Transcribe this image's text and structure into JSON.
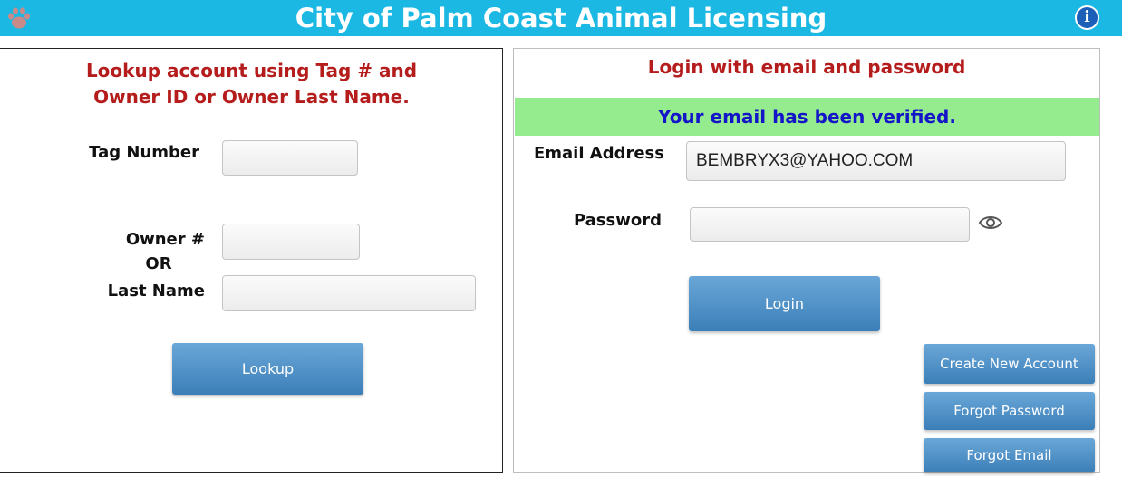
{
  "header": {
    "title": "City of Palm Coast Animal Licensing",
    "info_label": "i",
    "colors": {
      "background": "#1cb8e4",
      "text": "#ffffff"
    },
    "icons": {
      "logo": "paw-icon",
      "info": "info-icon"
    }
  },
  "lookup": {
    "heading_line1": "Lookup account using Tag # and",
    "heading_line2": "Owner ID or Owner Last Name.",
    "tag_label": "Tag Number",
    "tag_value": "",
    "owner_label": "Owner #",
    "or_label": "OR",
    "lastname_label": "Last Name",
    "owner_value": "",
    "lastname_value": "",
    "button_label": "Lookup"
  },
  "login": {
    "heading": "Login with email and password",
    "verified_message": "Your email has been verified.",
    "email_label": "Email Address",
    "email_value": "BEMBRYX3@YAHOO.COM",
    "password_label": "Password",
    "password_value": "",
    "button_label": "Login",
    "create_account_label": "Create New Account",
    "forgot_password_label": "Forgot Password",
    "forgot_email_label": "Forgot Email",
    "icons": {
      "show_password": "eye-icon"
    },
    "colors": {
      "heading": "#b51d1d",
      "verified_bg": "#95ec8e",
      "verified_text": "#1414c8"
    }
  }
}
